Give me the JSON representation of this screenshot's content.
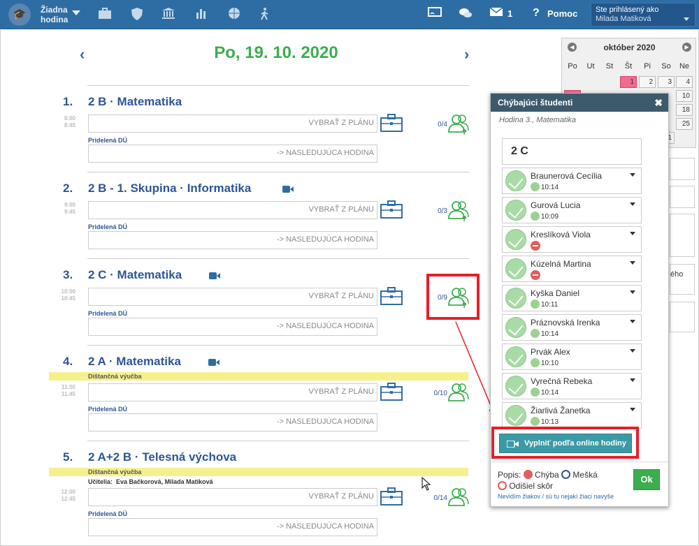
{
  "topbar": {
    "no_hour_line1": "Žiadna",
    "no_hour_line2": "hodina",
    "messages_count": "1",
    "help_label": "Pomoc",
    "user_caption": "Ste prihlásený ako",
    "user_name": "Milada Matiková"
  },
  "date_title": "Po, 19. 10. 2020",
  "nav": {
    "prev": "‹",
    "next": "›"
  },
  "lessons": [
    {
      "num": "1.",
      "name": "2 B · Matematika",
      "start": "8:00",
      "end": "8:45",
      "plan": "VYBRAŤ Z PLÁNU",
      "du_label": "Pridelená DÚ",
      "next": "-> NASLEDUJÚCA HODINA",
      "count": "0/4"
    },
    {
      "num": "2.",
      "name": "2 B - 1. Skupina · Informatika",
      "start": "9:00",
      "end": "9:45",
      "plan": "VYBRAŤ Z PLÁNU",
      "du_label": "Pridelená DÚ",
      "next": "-> NASLEDUJÚCA HODINA",
      "count": "0/3"
    },
    {
      "num": "3.",
      "name": "2 C · Matematika",
      "start": "10:00",
      "end": "10:45",
      "plan": "VYBRAŤ Z PLÁNU",
      "du_label": "Pridelená DÚ",
      "next": "-> NASLEDUJÚCA HODINA",
      "count": "0/9"
    },
    {
      "num": "4.",
      "name": "2 A · Matematika",
      "band": "Dištančná výučba",
      "start": "11:00",
      "end": "11:45",
      "plan": "VYBRAŤ Z PLÁNU",
      "du_label": "Pridelená DÚ",
      "next": "-> NASLEDUJÚCA HODINA",
      "count": "0/10"
    },
    {
      "num": "5.",
      "name": "2 A+2 B · Telesná výchova",
      "band": "Dištančná výučba",
      "teachers_label": "Učitelia:",
      "teachers": "Eva Bačkorová, Milada Matiková",
      "start": "12:00",
      "end": "12:45",
      "plan": "VYBRAŤ Z PLÁNU",
      "du_label": "Pridelená DÚ",
      "next": "-> NASLEDUJÚCA HODINA",
      "count": "0/14"
    }
  ],
  "calendar": {
    "month": "október 2020",
    "day_names": [
      "Po",
      "Ut",
      "St",
      "Št",
      "Pi",
      "So",
      "Ne"
    ],
    "week1": [
      "1",
      "2",
      "3",
      "4"
    ],
    "visible_right": [
      "10",
      "18",
      "25",
      "1"
    ]
  },
  "side_snippet": "ého",
  "panel": {
    "title": "Chýbajúci študenti",
    "close": "✖",
    "subtitle": "Hodina 3., Matematika",
    "class_name": "2 C",
    "students": [
      {
        "name": "Braunerová Cecília",
        "time": "10:14",
        "status": "present"
      },
      {
        "name": "Gurová Lucia",
        "time": "10:09",
        "status": "present"
      },
      {
        "name": "Kreslíková Viola",
        "time": "",
        "status": "absent"
      },
      {
        "name": "Kúzelná Martina",
        "time": "",
        "status": "absent"
      },
      {
        "name": "Kyška Daniel",
        "time": "10:11",
        "status": "present"
      },
      {
        "name": "Práznovská Irenka",
        "time": "10:14",
        "status": "present"
      },
      {
        "name": "Prvák Alex",
        "time": "10:10",
        "status": "present"
      },
      {
        "name": "Vyrečná Rebeka",
        "time": "10:14",
        "status": "present"
      },
      {
        "name": "Žiarlivá Žanetka",
        "time": "10:13",
        "status": "present"
      }
    ],
    "fill_button": "Vyplniť podľa online hodiny",
    "legend_label": "Popis:",
    "legend_error": "Chýba",
    "legend_late": "Mešká",
    "legend_left": "Odišiel skôr",
    "link_text": "Nevidím žiakov / sú tu nejakí žiaci navyše",
    "ok": "Ok"
  },
  "colors": {
    "accent": "#2e6da4",
    "title_green": "#3cae4e",
    "highlight_red": "#e81e2b",
    "band_yellow": "#f6f08c"
  }
}
